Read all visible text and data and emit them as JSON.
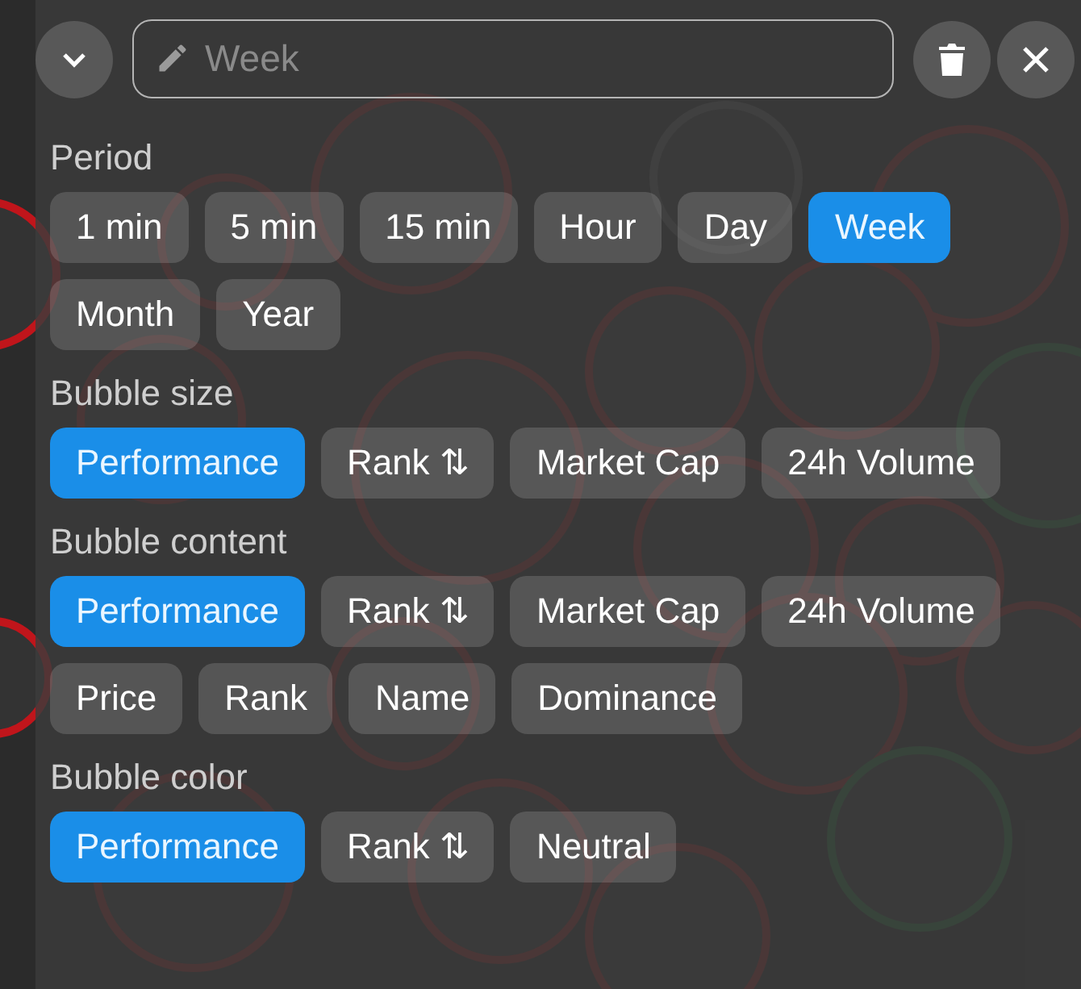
{
  "search": {
    "placeholder": "Week"
  },
  "sections": [
    {
      "label": "Period",
      "options": [
        {
          "label": "1 min",
          "selected": false
        },
        {
          "label": "5 min",
          "selected": false
        },
        {
          "label": "15 min",
          "selected": false
        },
        {
          "label": "Hour",
          "selected": false
        },
        {
          "label": "Day",
          "selected": false
        },
        {
          "label": "Week",
          "selected": true
        },
        {
          "label": "Month",
          "selected": false
        },
        {
          "label": "Year",
          "selected": false
        }
      ]
    },
    {
      "label": "Bubble size",
      "options": [
        {
          "label": "Performance",
          "selected": true
        },
        {
          "label": "Rank ⇅",
          "selected": false
        },
        {
          "label": "Market Cap",
          "selected": false
        },
        {
          "label": "24h Volume",
          "selected": false
        }
      ]
    },
    {
      "label": "Bubble content",
      "options": [
        {
          "label": "Performance",
          "selected": true
        },
        {
          "label": "Rank ⇅",
          "selected": false
        },
        {
          "label": "Market Cap",
          "selected": false
        },
        {
          "label": "24h Volume",
          "selected": false
        },
        {
          "label": "Price",
          "selected": false
        },
        {
          "label": "Rank",
          "selected": false
        },
        {
          "label": "Name",
          "selected": false
        },
        {
          "label": "Dominance",
          "selected": false
        }
      ]
    },
    {
      "label": "Bubble color",
      "options": [
        {
          "label": "Performance",
          "selected": true
        },
        {
          "label": "Rank ⇅",
          "selected": false
        },
        {
          "label": "Neutral",
          "selected": false
        }
      ]
    }
  ]
}
